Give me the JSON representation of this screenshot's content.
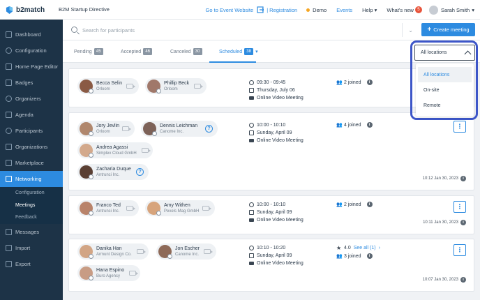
{
  "app": {
    "brand": "b2match",
    "event_title": "B2M Startup Directive"
  },
  "topbar": {
    "event_website": "Go to Event Website",
    "registration": "Registration",
    "demo": "Demo",
    "events": "Events",
    "help": "Help",
    "whats_new": "What's new",
    "whats_new_count": "5",
    "user_name": "Sarah Smith"
  },
  "sidebar": {
    "items": [
      {
        "label": "Dashboard",
        "icon": "dashboard-icon"
      },
      {
        "label": "Configuration",
        "icon": "gear-icon"
      },
      {
        "label": "Home Page Editor",
        "icon": "page-icon"
      },
      {
        "label": "Badges",
        "icon": "badge-icon"
      },
      {
        "label": "Organizers",
        "icon": "organizers-icon"
      },
      {
        "label": "Agenda",
        "icon": "calendar-icon"
      },
      {
        "label": "Participants",
        "icon": "user-icon"
      },
      {
        "label": "Organizations",
        "icon": "building-icon"
      },
      {
        "label": "Marketplace",
        "icon": "market-icon"
      },
      {
        "label": "Networking",
        "icon": "networking-icon"
      }
    ],
    "networking_sub": [
      "Configuration",
      "Meetings",
      "Feedback"
    ],
    "bottom_items": [
      {
        "label": "Messages",
        "icon": "mail-icon"
      },
      {
        "label": "Import",
        "icon": "import-icon"
      },
      {
        "label": "Export",
        "icon": "export-icon"
      }
    ]
  },
  "search": {
    "placeholder": "Search for participants",
    "create_label": "Create meeting"
  },
  "tabs": [
    {
      "label": "Pending",
      "count": "45"
    },
    {
      "label": "Accepted",
      "count": "46"
    },
    {
      "label": "Canceled",
      "count": "30"
    },
    {
      "label": "Scheduled",
      "count": "38"
    }
  ],
  "location_filter": {
    "selected": "All locations",
    "options": [
      "All locations",
      "On-site",
      "Remote"
    ]
  },
  "meetings": [
    {
      "participants": [
        {
          "name": "Becca Selin",
          "org": "Orloom"
        },
        {
          "name": "Phillip Beck",
          "org": "Orloom"
        }
      ],
      "time": "09:30 - 09:45",
      "date": "Thursday, July 06",
      "location": "Online Video Meeting",
      "joined": "2 joined"
    },
    {
      "participants": [
        {
          "name": "Jory Jevlin",
          "org": "Orloom"
        },
        {
          "name": "Dennis Leichman",
          "org": "Canome Inc."
        },
        {
          "name": "Andrea Agassi",
          "org": "Simplex Cloud GmbH"
        },
        {
          "name": "Zacharia Duque",
          "org": "Antrunci Inc."
        }
      ],
      "time": "10:00 - 10:10",
      "date": "Sunday, April 09",
      "location": "Online Video Meeting",
      "joined": "4 joined",
      "stamp": "10:12 Jan 30, 2023"
    },
    {
      "participants": [
        {
          "name": "Franco Ted",
          "org": "Antrunci Inc."
        },
        {
          "name": "Amy Withen",
          "org": "Pexels Mag GmbH"
        }
      ],
      "time": "10:00 - 10:10",
      "date": "Sunday, April 09",
      "location": "Online Video Meeting",
      "joined": "2 joined",
      "stamp": "10:11 Jan 30, 2023"
    },
    {
      "participants": [
        {
          "name": "Danika Han",
          "org": "Armunt Design Co."
        },
        {
          "name": "Jon Escher",
          "org": "Canome Inc."
        },
        {
          "name": "Hana Espino",
          "org": "Buro Agency"
        }
      ],
      "time": "10:10 - 10:20",
      "date": "Sunday, April 09",
      "location": "Online Video Meeting",
      "rating": "4.0",
      "see_all": "See all (1)",
      "joined": "3 joined",
      "stamp": "10:07 Jan 30, 2023"
    }
  ],
  "colors": {
    "accent": "#2d8be0",
    "sidebar": "#1d3347",
    "highlight": "#3d56c8"
  }
}
